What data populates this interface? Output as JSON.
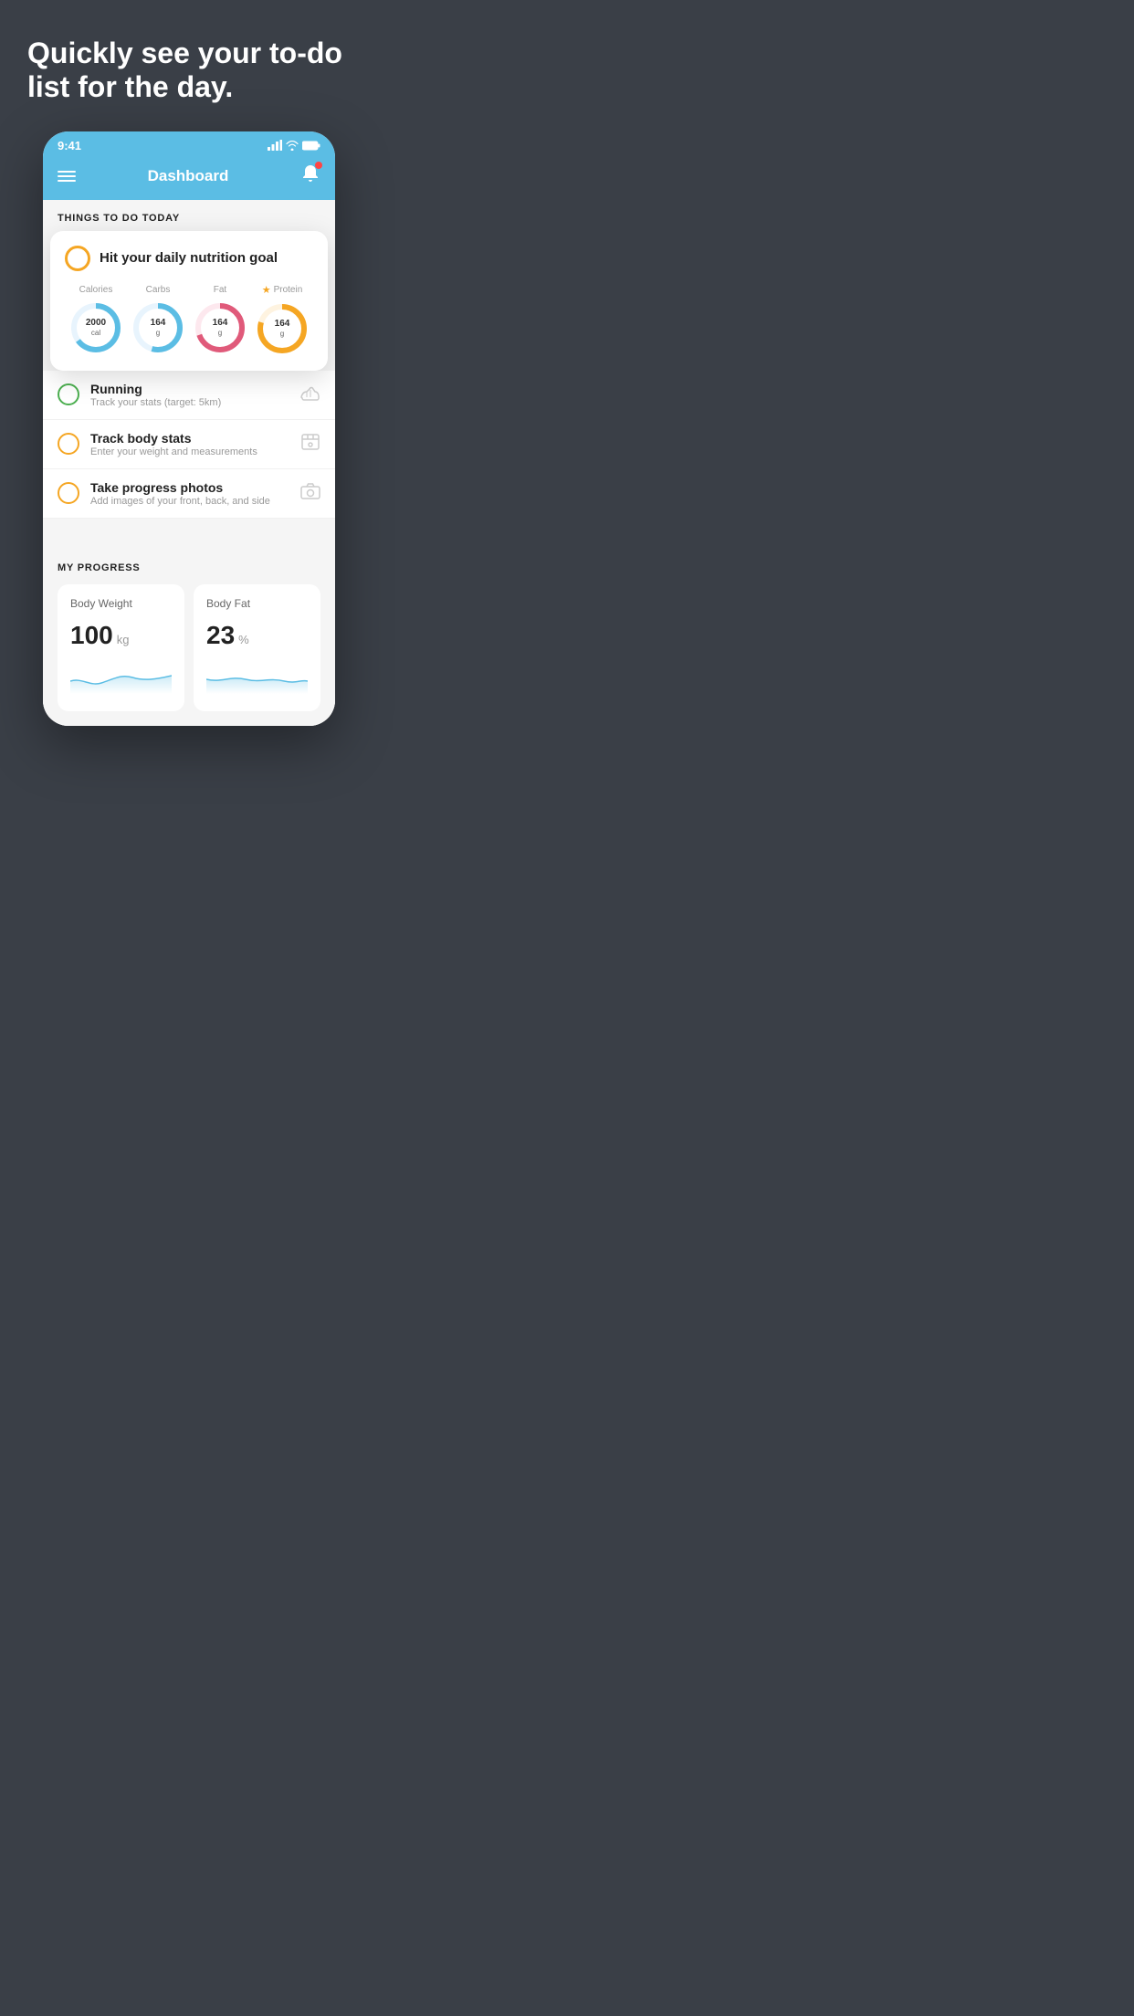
{
  "page": {
    "headline": "Quickly see your to-do list for the day.",
    "background_color": "#3a3f47"
  },
  "phone": {
    "status_bar": {
      "time": "9:41",
      "signal_icon": "signal-icon",
      "wifi_icon": "wifi-icon",
      "battery_icon": "battery-icon"
    },
    "nav": {
      "title": "Dashboard",
      "menu_icon": "hamburger-icon",
      "bell_icon": "bell-icon"
    },
    "section_today": {
      "label": "THINGS TO DO TODAY"
    },
    "nutrition_card": {
      "title": "Hit your daily nutrition goal",
      "stats": [
        {
          "label": "Calories",
          "value": "2000",
          "unit": "cal",
          "color": "#5bbde4",
          "pct": 65
        },
        {
          "label": "Carbs",
          "value": "164",
          "unit": "g",
          "color": "#5bbde4",
          "pct": 55
        },
        {
          "label": "Fat",
          "value": "164",
          "unit": "g",
          "color": "#e05a7a",
          "pct": 70
        },
        {
          "label": "Protein",
          "value": "164",
          "unit": "g",
          "color": "#f5a623",
          "pct": 80,
          "starred": true
        }
      ]
    },
    "todo_items": [
      {
        "id": "running",
        "title": "Running",
        "subtitle": "Track your stats (target: 5km)",
        "check_color": "green",
        "icon": "shoe-icon"
      },
      {
        "id": "body-stats",
        "title": "Track body stats",
        "subtitle": "Enter your weight and measurements",
        "check_color": "yellow",
        "icon": "scale-icon"
      },
      {
        "id": "progress-photos",
        "title": "Take progress photos",
        "subtitle": "Add images of your front, back, and side",
        "check_color": "yellow",
        "icon": "camera-icon"
      }
    ],
    "progress_section": {
      "label": "MY PROGRESS",
      "cards": [
        {
          "id": "body-weight",
          "title": "Body Weight",
          "value": "100",
          "unit": "kg"
        },
        {
          "id": "body-fat",
          "title": "Body Fat",
          "value": "23",
          "unit": "%"
        }
      ]
    }
  }
}
